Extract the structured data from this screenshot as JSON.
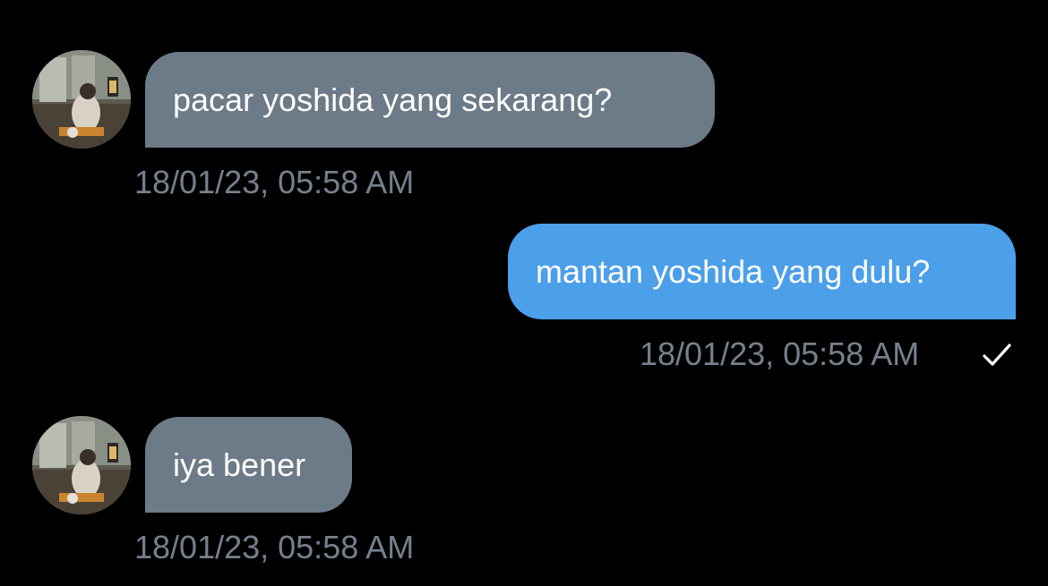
{
  "conversation": {
    "messages": [
      {
        "direction": "incoming",
        "text": "pacar yoshida yang sekarang?",
        "timestamp": "18/01/23, 05:58 AM",
        "avatar": "contact-avatar"
      },
      {
        "direction": "outgoing",
        "text": "mantan yoshida yang dulu?",
        "timestamp": "18/01/23, 05:58 AM",
        "status_icon": "check-icon"
      },
      {
        "direction": "incoming",
        "text": "iya bener",
        "timestamp": "18/01/23, 05:58 AM",
        "avatar": "contact-avatar"
      }
    ]
  },
  "colors": {
    "background": "#000000",
    "incoming_bubble": "#6d7a87",
    "outgoing_bubble": "#4c9fe9",
    "timestamp": "#76808c",
    "text": "#ffffff"
  }
}
